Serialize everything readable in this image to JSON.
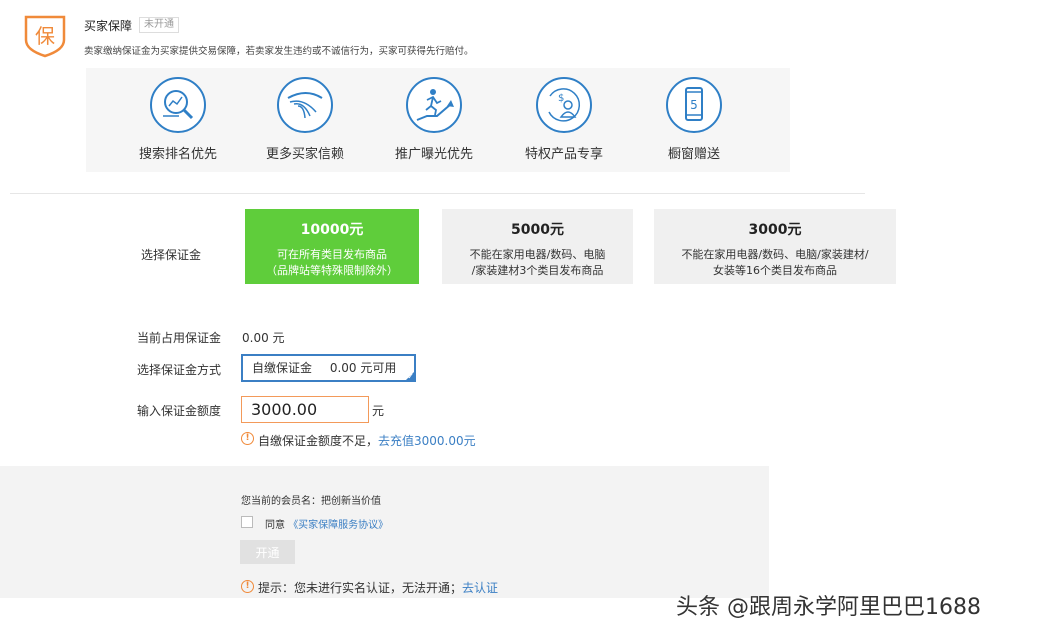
{
  "header": {
    "badge_char": "保",
    "title": "买家保障",
    "status": "未开通",
    "description": "卖家缴纳保证金为买家提供交易保障，若卖家发生违约或不诚信行为，买家可获得先行赔付。"
  },
  "benefits": [
    {
      "label": "搜索排名优先",
      "icon": "search-chart-icon"
    },
    {
      "label": "更多买家信赖",
      "icon": "trust-wave-icon"
    },
    {
      "label": "推广曝光优先",
      "icon": "running-growth-icon"
    },
    {
      "label": "特权产品专享",
      "icon": "privilege-user-icon"
    },
    {
      "label": "橱窗赠送",
      "icon": "phone-window-icon"
    }
  ],
  "deposit": {
    "label": "选择保证金",
    "options": [
      {
        "amount": "10000元",
        "line1": "可在所有类目发布商品",
        "line2": "（品牌站等特殊限制除外）",
        "selected": true
      },
      {
        "amount": "5000元",
        "line1": "不能在家用电器/数码、电脑",
        "line2": "/家装建材3个类目发布商品",
        "selected": false
      },
      {
        "amount": "3000元",
        "line1": "不能在家用电器/数码、电脑/家装建材/",
        "line2": "女装等16个类目发布商品",
        "selected": false
      }
    ]
  },
  "current": {
    "label": "当前占用保证金",
    "value": "0.00 元"
  },
  "method": {
    "label": "选择保证金方式",
    "option_name": "自缴保证金",
    "available": "0.00 元可用"
  },
  "amount": {
    "label": "输入保证金额度",
    "value": "3000.00",
    "unit": "元"
  },
  "amount_warning": {
    "text": "自缴保证金额度不足，",
    "link": "去充值3000.00元"
  },
  "bottom": {
    "member_text": "您当前的会员名：把创新当价值",
    "agree_text": "同意",
    "agreement_link": "《买家保障服务协议》",
    "open_button": "开通",
    "tip_text": "提示：您未进行实名认证，无法开通；",
    "tip_link": "去认证"
  },
  "watermark": "头条 @跟周永学阿里巴巴1688",
  "colors": {
    "accent_orange": "#f08a3a",
    "selected_green": "#5fcd3b",
    "link_blue": "#3b7fc4",
    "icon_blue": "#2f7fc6"
  }
}
